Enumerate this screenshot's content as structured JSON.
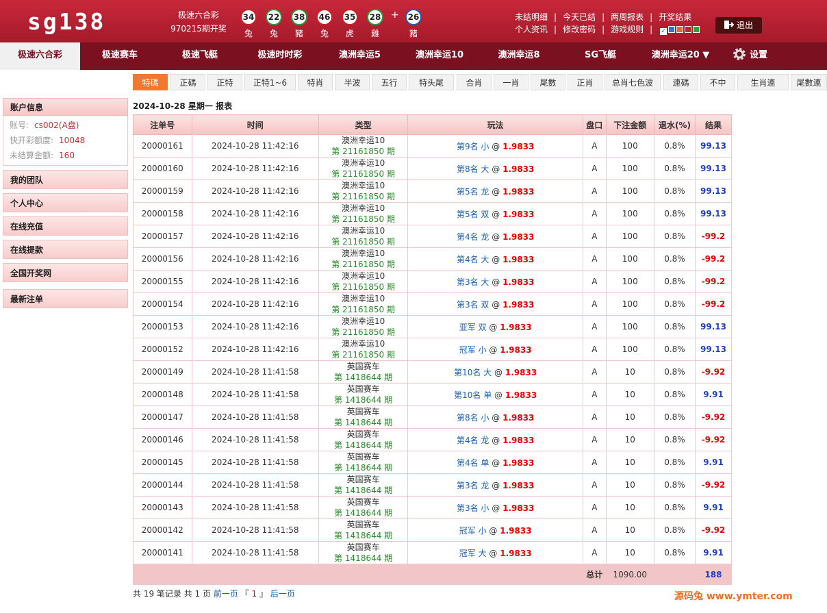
{
  "brand": {
    "logo": "sg138"
  },
  "draw": {
    "lottery": "极速六合彩",
    "issue": "970215期开奖",
    "plus": "+"
  },
  "balls": [
    {
      "num": "34",
      "zodiac": "兔",
      "color": "red"
    },
    {
      "num": "22",
      "zodiac": "兔",
      "color": "green"
    },
    {
      "num": "38",
      "zodiac": "豬",
      "color": "green"
    },
    {
      "num": "46",
      "zodiac": "兔",
      "color": "red"
    },
    {
      "num": "35",
      "zodiac": "虎",
      "color": "red"
    },
    {
      "num": "28",
      "zodiac": "雞",
      "color": "green"
    },
    {
      "num": "26",
      "zodiac": "豬",
      "color": "blue"
    }
  ],
  "top_links": {
    "row1": [
      "未结明细",
      "今天已结",
      "两周报表",
      "开奖结果"
    ],
    "row2": [
      "个人资讯",
      "修改密码",
      "游戏规则"
    ],
    "separator": "|",
    "check": "✓",
    "colors": [
      "#3a6fd8",
      "#e07020",
      "#c82020",
      "#30a030"
    ]
  },
  "logout": {
    "label": "退出",
    "icon": "logout-icon"
  },
  "nav": [
    {
      "label": "极速六合彩",
      "active": true
    },
    {
      "label": "极速赛车"
    },
    {
      "label": "极速飞艇"
    },
    {
      "label": "极速时时彩"
    },
    {
      "label": "澳洲幸运5"
    },
    {
      "label": "澳洲幸运10"
    },
    {
      "label": "澳洲幸运8"
    },
    {
      "label": "SG飞艇"
    },
    {
      "label": "澳洲幸运20 ▼"
    },
    {
      "label": "设置",
      "icon": "gear-icon"
    }
  ],
  "subnav": [
    "特碼",
    "正碼",
    "正特",
    "正特1~6",
    "特肖",
    "半波",
    "五行",
    "特头尾",
    "合肖",
    "一肖",
    "尾數",
    "正肖",
    "总肖七色波",
    "連碼",
    "不中",
    "生肖連",
    "尾數連"
  ],
  "sidebar": {
    "account_title": "账户信息",
    "account": [
      {
        "label": "账号:",
        "value": "cs002(A盘)"
      },
      {
        "label": "快开彩额度:",
        "value": "10048"
      },
      {
        "label": "未结算金额:",
        "value": "160"
      }
    ],
    "items": [
      "我的团队",
      "个人中心",
      "在线充值",
      "在线提款",
      "全国开奖网",
      "最新注单"
    ]
  },
  "report": {
    "title": "2024-10-28 星期一 报表",
    "columns": [
      "注单号",
      "时间",
      "类型",
      "玩法",
      "盘口",
      "下注金额",
      "退水(%)",
      "结果"
    ],
    "rows": [
      {
        "id": "20000161",
        "time": "2024-10-28 11:42:16",
        "type": "澳洲幸运10",
        "period": "第 21161850 期",
        "play": "第9名 小",
        "at": "@",
        "odds": "1.9833",
        "pan": "A",
        "amount": "100",
        "rebate": "0.8%",
        "result": "99.13",
        "win": true
      },
      {
        "id": "20000160",
        "time": "2024-10-28 11:42:16",
        "type": "澳洲幸运10",
        "period": "第 21161850 期",
        "play": "第8名 大",
        "at": "@",
        "odds": "1.9833",
        "pan": "A",
        "amount": "100",
        "rebate": "0.8%",
        "result": "99.13",
        "win": true
      },
      {
        "id": "20000159",
        "time": "2024-10-28 11:42:16",
        "type": "澳洲幸运10",
        "period": "第 21161850 期",
        "play": "第5名 龙",
        "at": "@",
        "odds": "1.9833",
        "pan": "A",
        "amount": "100",
        "rebate": "0.8%",
        "result": "99.13",
        "win": true
      },
      {
        "id": "20000158",
        "time": "2024-10-28 11:42:16",
        "type": "澳洲幸运10",
        "period": "第 21161850 期",
        "play": "第5名 双",
        "at": "@",
        "odds": "1.9833",
        "pan": "A",
        "amount": "100",
        "rebate": "0.8%",
        "result": "99.13",
        "win": true
      },
      {
        "id": "20000157",
        "time": "2024-10-28 11:42:16",
        "type": "澳洲幸运10",
        "period": "第 21161850 期",
        "play": "第4名 龙",
        "at": "@",
        "odds": "1.9833",
        "pan": "A",
        "amount": "100",
        "rebate": "0.8%",
        "result": "-99.2",
        "win": false
      },
      {
        "id": "20000156",
        "time": "2024-10-28 11:42:16",
        "type": "澳洲幸运10",
        "period": "第 21161850 期",
        "play": "第4名 大",
        "at": "@",
        "odds": "1.9833",
        "pan": "A",
        "amount": "100",
        "rebate": "0.8%",
        "result": "-99.2",
        "win": false
      },
      {
        "id": "20000155",
        "time": "2024-10-28 11:42:16",
        "type": "澳洲幸运10",
        "period": "第 21161850 期",
        "play": "第3名 大",
        "at": "@",
        "odds": "1.9833",
        "pan": "A",
        "amount": "100",
        "rebate": "0.8%",
        "result": "-99.2",
        "win": false
      },
      {
        "id": "20000154",
        "time": "2024-10-28 11:42:16",
        "type": "澳洲幸运10",
        "period": "第 21161850 期",
        "play": "第3名 双",
        "at": "@",
        "odds": "1.9833",
        "pan": "A",
        "amount": "100",
        "rebate": "0.8%",
        "result": "-99.2",
        "win": false
      },
      {
        "id": "20000153",
        "time": "2024-10-28 11:42:16",
        "type": "澳洲幸运10",
        "period": "第 21161850 期",
        "play": "亚军 双",
        "at": "@",
        "odds": "1.9833",
        "pan": "A",
        "amount": "100",
        "rebate": "0.8%",
        "result": "99.13",
        "win": true
      },
      {
        "id": "20000152",
        "time": "2024-10-28 11:42:16",
        "type": "澳洲幸运10",
        "period": "第 21161850 期",
        "play": "冠军 小",
        "at": "@",
        "odds": "1.9833",
        "pan": "A",
        "amount": "100",
        "rebate": "0.8%",
        "result": "99.13",
        "win": true
      },
      {
        "id": "20000149",
        "time": "2024-10-28 11:41:58",
        "type": "英国赛车",
        "period": "第 1418644 期",
        "play": "第10名 大",
        "at": "@",
        "odds": "1.9833",
        "pan": "A",
        "amount": "10",
        "rebate": "0.8%",
        "result": "-9.92",
        "win": false
      },
      {
        "id": "20000148",
        "time": "2024-10-28 11:41:58",
        "type": "英国赛车",
        "period": "第 1418644 期",
        "play": "第10名 单",
        "at": "@",
        "odds": "1.9833",
        "pan": "A",
        "amount": "10",
        "rebate": "0.8%",
        "result": "9.91",
        "win": true
      },
      {
        "id": "20000147",
        "time": "2024-10-28 11:41:58",
        "type": "英国赛车",
        "period": "第 1418644 期",
        "play": "第8名 小",
        "at": "@",
        "odds": "1.9833",
        "pan": "A",
        "amount": "10",
        "rebate": "0.8%",
        "result": "-9.92",
        "win": false
      },
      {
        "id": "20000146",
        "time": "2024-10-28 11:41:58",
        "type": "英国赛车",
        "period": "第 1418644 期",
        "play": "第4名 龙",
        "at": "@",
        "odds": "1.9833",
        "pan": "A",
        "amount": "10",
        "rebate": "0.8%",
        "result": "-9.92",
        "win": false
      },
      {
        "id": "20000145",
        "time": "2024-10-28 11:41:58",
        "type": "英国赛车",
        "period": "第 1418644 期",
        "play": "第4名 单",
        "at": "@",
        "odds": "1.9833",
        "pan": "A",
        "amount": "10",
        "rebate": "0.8%",
        "result": "9.91",
        "win": true
      },
      {
        "id": "20000144",
        "time": "2024-10-28 11:41:58",
        "type": "英国赛车",
        "period": "第 1418644 期",
        "play": "第3名 龙",
        "at": "@",
        "odds": "1.9833",
        "pan": "A",
        "amount": "10",
        "rebate": "0.8%",
        "result": "-9.92",
        "win": false
      },
      {
        "id": "20000143",
        "time": "2024-10-28 11:41:58",
        "type": "英国赛车",
        "period": "第 1418644 期",
        "play": "第3名 小",
        "at": "@",
        "odds": "1.9833",
        "pan": "A",
        "amount": "10",
        "rebate": "0.8%",
        "result": "9.91",
        "win": true
      },
      {
        "id": "20000142",
        "time": "2024-10-28 11:41:58",
        "type": "英国赛车",
        "period": "第 1418644 期",
        "play": "冠军 小",
        "at": "@",
        "odds": "1.9833",
        "pan": "A",
        "amount": "10",
        "rebate": "0.8%",
        "result": "-9.92",
        "win": false
      },
      {
        "id": "20000141",
        "time": "2024-10-28 11:41:58",
        "type": "英国赛车",
        "period": "第 1418644 期",
        "play": "冠军 大",
        "at": "@",
        "odds": "1.9833",
        "pan": "A",
        "amount": "10",
        "rebate": "0.8%",
        "result": "9.91",
        "win": true
      }
    ],
    "total": {
      "label": "总计",
      "amount": "1090.00",
      "result": "188"
    }
  },
  "pager": {
    "summary": "共 19 笔记录 共 1 页",
    "prev": "前一页",
    "lb": "『",
    "page": "1",
    "rb": "』",
    "next": "后一页"
  },
  "watermark": "源码兔 www.ymter.com"
}
